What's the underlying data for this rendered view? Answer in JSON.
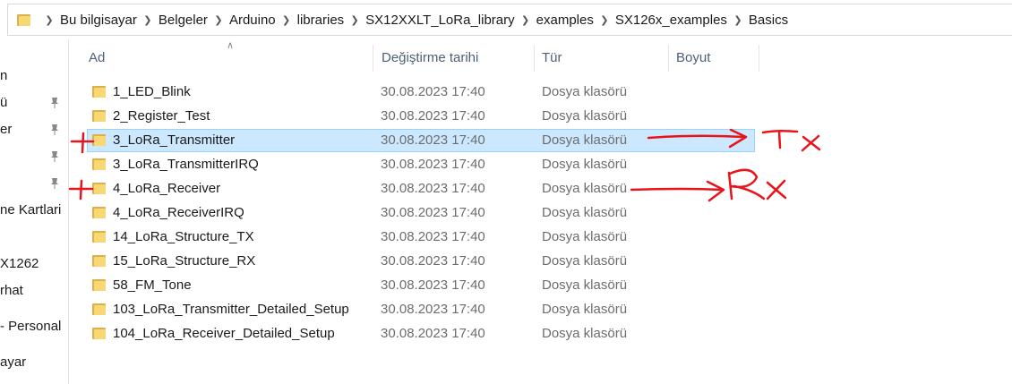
{
  "breadcrumb": [
    "Bu bilgisayar",
    "Belgeler",
    "Arduino",
    "libraries",
    "SX12XXLT_LoRa_library",
    "examples",
    "SX126x_examples",
    "Basics"
  ],
  "nav_items": [
    "n",
    "ü",
    "er",
    "ne Kartlari",
    "X1262",
    "rhat",
    "- Personal",
    "ayar"
  ],
  "columns": {
    "name": "Ad",
    "date": "Değiştirme tarihi",
    "type": "Tür",
    "size": "Boyut"
  },
  "files": [
    {
      "name": "1_LED_Blink",
      "date": "30.08.2023 17:40",
      "type": "Dosya klasörü"
    },
    {
      "name": "2_Register_Test",
      "date": "30.08.2023 17:40",
      "type": "Dosya klasörü"
    },
    {
      "name": "3_LoRa_Transmitter",
      "date": "30.08.2023 17:40",
      "type": "Dosya klasörü",
      "selected": true
    },
    {
      "name": "3_LoRa_TransmitterIRQ",
      "date": "30.08.2023 17:40",
      "type": "Dosya klasörü"
    },
    {
      "name": "4_LoRa_Receiver",
      "date": "30.08.2023 17:40",
      "type": "Dosya klasörü"
    },
    {
      "name": "4_LoRa_ReceiverIRQ",
      "date": "30.08.2023 17:40",
      "type": "Dosya klasörü"
    },
    {
      "name": "14_LoRa_Structure_TX",
      "date": "30.08.2023 17:40",
      "type": "Dosya klasörü"
    },
    {
      "name": "15_LoRa_Structure_RX",
      "date": "30.08.2023 17:40",
      "type": "Dosya klasörü"
    },
    {
      "name": "58_FM_Tone",
      "date": "30.08.2023 17:40",
      "type": "Dosya klasörü"
    },
    {
      "name": "103_LoRa_Transmitter_Detailed_Setup",
      "date": "30.08.2023 17:40",
      "type": "Dosya klasörü"
    },
    {
      "name": "104_LoRa_Receiver_Detailed_Setup",
      "date": "30.08.2023 17:40",
      "type": "Dosya klasörü"
    }
  ],
  "annotations": {
    "tx": "Tx",
    "rx": "Rx",
    "annotation_color": "#e8141c"
  },
  "colors": {
    "selected_row": "#cce8ff",
    "selected_border": "#99d1ff",
    "header_text": "#4c607a"
  }
}
